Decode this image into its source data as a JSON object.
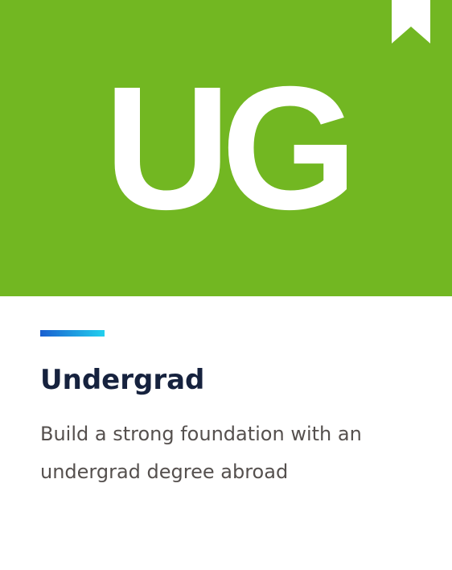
{
  "banner": {
    "logo_text": "UG",
    "background_color": "#72b722",
    "bookmark_icon": "bookmark-icon"
  },
  "card": {
    "accent_gradient": [
      "#1a5fd0",
      "#22d0ee"
    ],
    "title": "Undergrad",
    "description": "Build a strong foundation with an undergrad degree abroad"
  }
}
